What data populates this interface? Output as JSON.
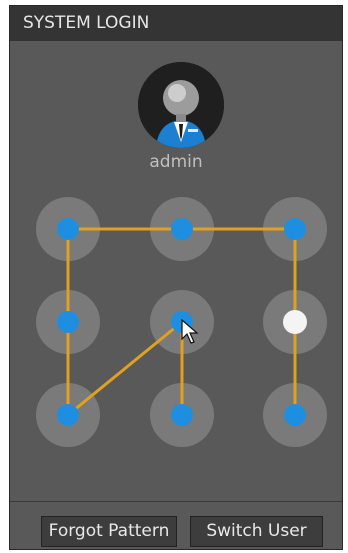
{
  "title": "SYSTEM LOGIN",
  "user": {
    "name": "admin",
    "avatar_icon": "user-avatar-icon"
  },
  "pattern": {
    "grid": [
      3,
      3
    ],
    "node_colors": {
      "selected": "#1e8fe0",
      "idle": "#f4f4f4",
      "halo": "#7a7a7a",
      "line": "#e0a020"
    },
    "nodes": [
      {
        "id": 1,
        "state": "selected"
      },
      {
        "id": 2,
        "state": "selected"
      },
      {
        "id": 3,
        "state": "selected"
      },
      {
        "id": 4,
        "state": "selected"
      },
      {
        "id": 5,
        "state": "selected"
      },
      {
        "id": 6,
        "state": "idle"
      },
      {
        "id": 7,
        "state": "selected"
      },
      {
        "id": 8,
        "state": "selected"
      },
      {
        "id": 9,
        "state": "selected"
      }
    ],
    "path": [
      8,
      5,
      7,
      4,
      1,
      2,
      3,
      9
    ]
  },
  "buttons": {
    "forgot": "Forgot Pattern",
    "switch": "Switch User"
  }
}
